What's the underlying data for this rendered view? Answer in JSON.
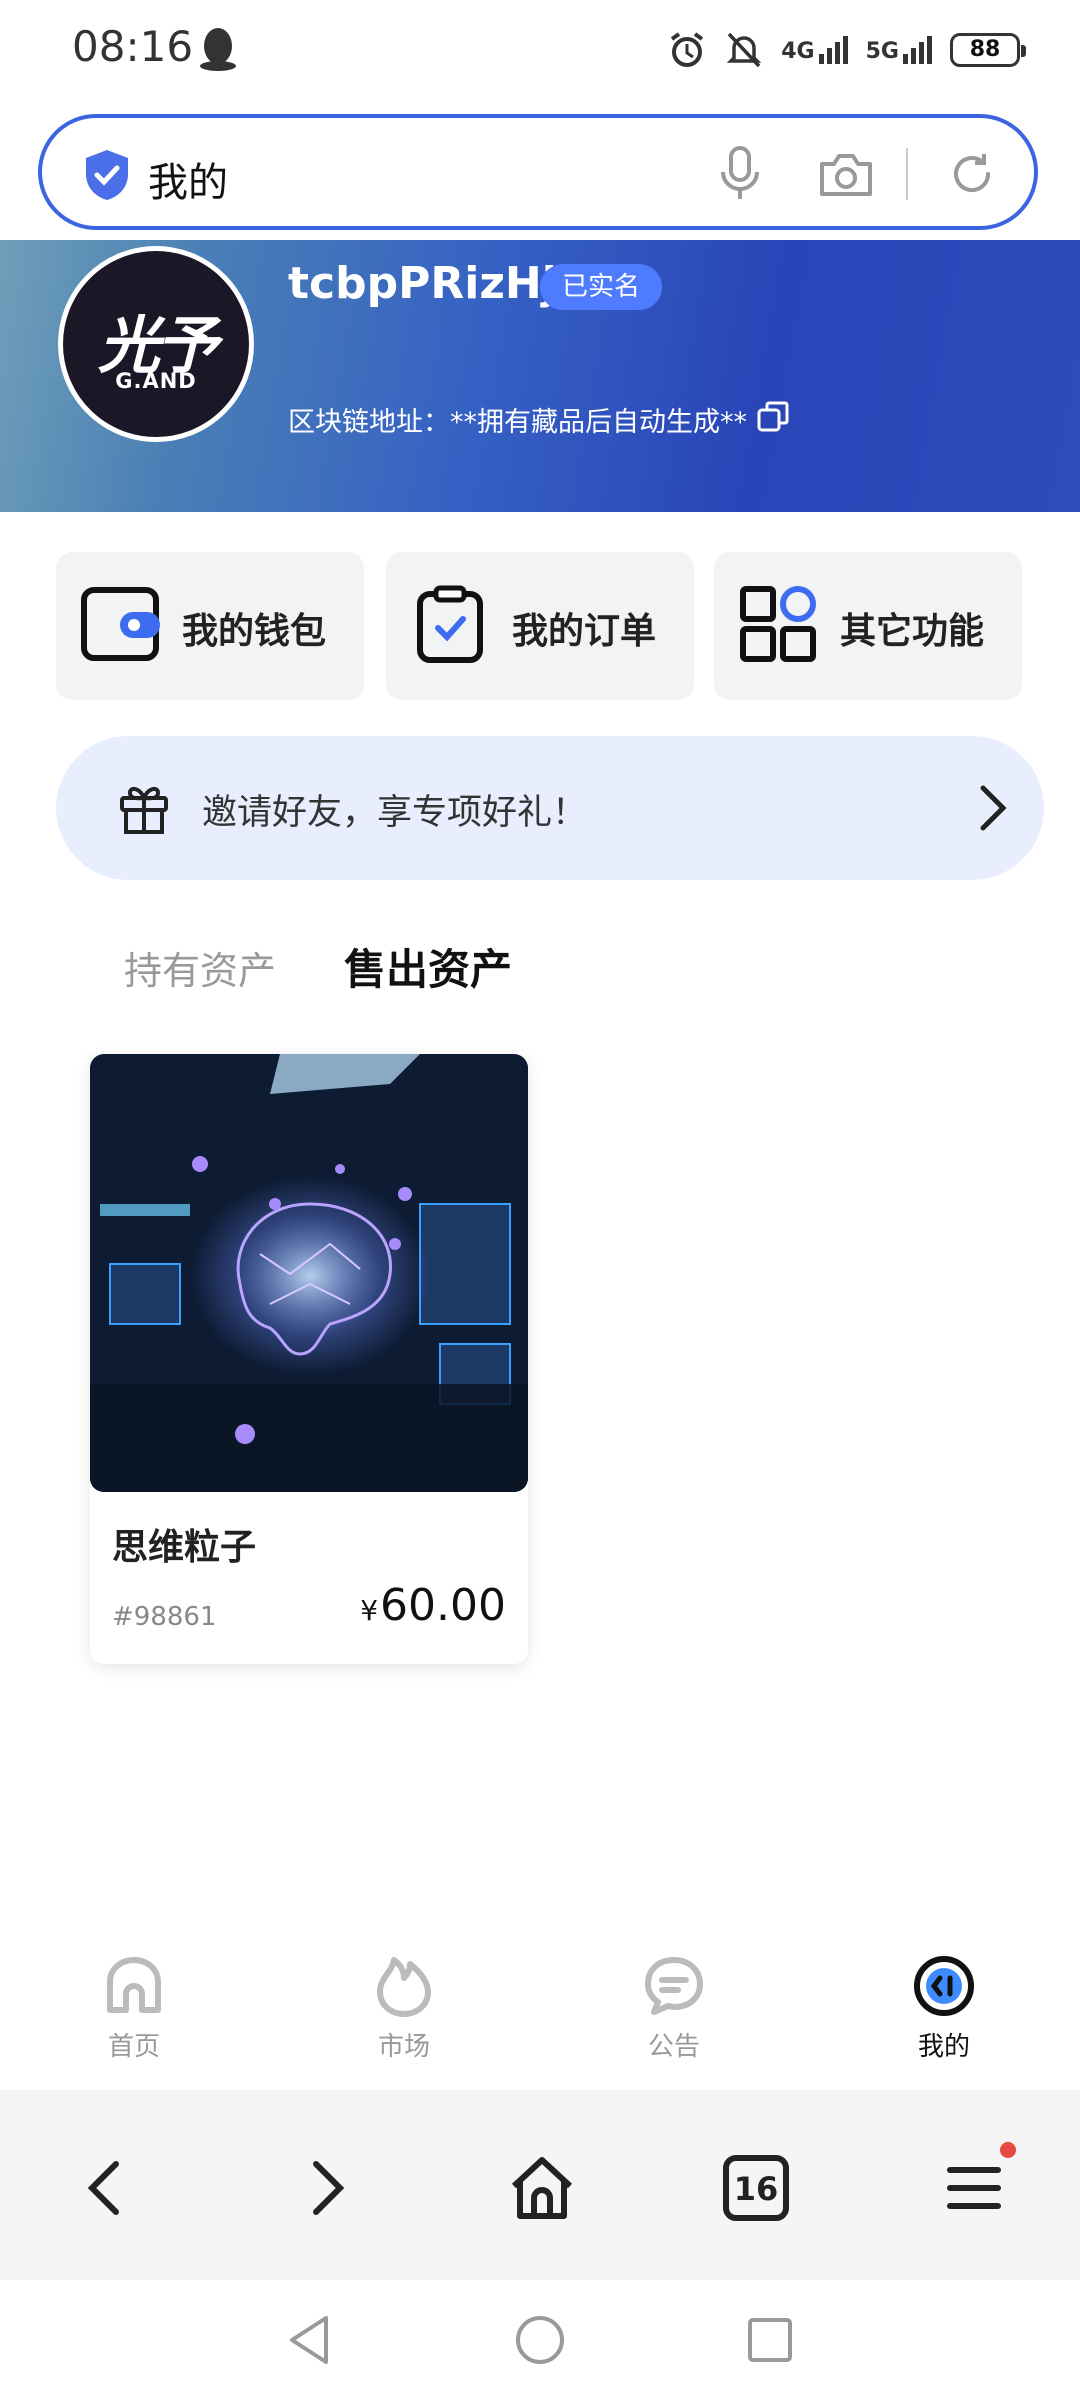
{
  "status_bar": {
    "time": "08:16",
    "network_1": "4G",
    "network_2": "5G",
    "battery": "88"
  },
  "search": {
    "text": "我的"
  },
  "profile": {
    "avatar_line1": "光予",
    "avatar_line2": "G.AND",
    "username": "tcbpPRizHj",
    "verified_badge": "已实名",
    "chain_address": "区块链地址：**拥有藏品后自动生成**"
  },
  "functions": [
    {
      "label": "我的钱包",
      "icon": "wallet-icon"
    },
    {
      "label": "我的订单",
      "icon": "order-clipboard-icon"
    },
    {
      "label": "其它功能",
      "icon": "grid-apps-icon"
    }
  ],
  "invite": {
    "text": "邀请好友，享专项好礼！",
    "icon": "gift-icon"
  },
  "tabs": {
    "held": "持有资产",
    "sold": "售出资产",
    "active": "sold"
  },
  "card": {
    "title": "思维粒子",
    "id": "#98861",
    "currency": "¥",
    "price": "60.00"
  },
  "tabbar": [
    {
      "label": "首页",
      "icon": "home-icon",
      "active": false
    },
    {
      "label": "市场",
      "icon": "market-flame-icon",
      "active": false
    },
    {
      "label": "公告",
      "icon": "announcement-icon",
      "active": false
    },
    {
      "label": "我的",
      "icon": "profile-icon",
      "active": true
    }
  ],
  "browser": {
    "tab_count": "16"
  },
  "colors": {
    "accent": "#3b64e0",
    "badge": "#4f7bff",
    "invite_bg": "#e8eefd",
    "notification_dot": "#e8483f"
  }
}
